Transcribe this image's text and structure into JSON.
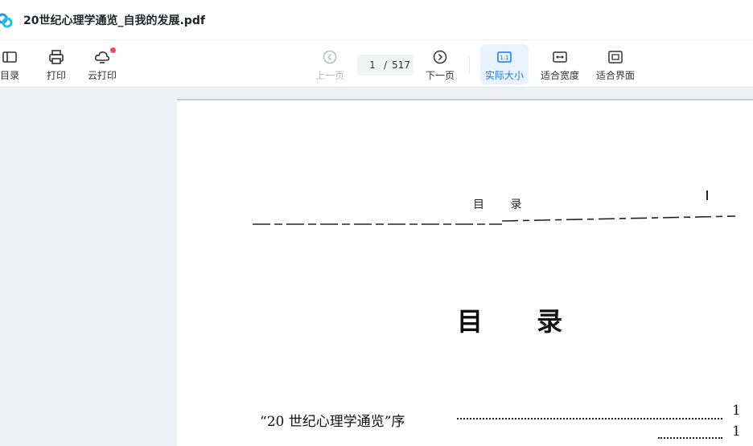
{
  "title_bar": {
    "document_title": "20世纪心理学通览_自我的发展.pdf",
    "logo_icon": "baidu-netdisk-logo"
  },
  "toolbar": {
    "left_tools": [
      {
        "label": "目录",
        "icon": "sidebar-panel-icon"
      },
      {
        "label": "打印",
        "icon": "printer-icon"
      },
      {
        "label": "云打印",
        "icon": "cloud-print-icon",
        "has_notification_dot": true
      }
    ],
    "prev_page_label": "上一页",
    "next_page_label": "下一页",
    "current_page": "1",
    "page_separator": "/",
    "total_pages": "517",
    "view_modes": [
      {
        "label": "实际大小",
        "icon": "actual-size-icon",
        "icon_text": "1:1",
        "active": true
      },
      {
        "label": "适合宽度",
        "icon": "fit-width-icon",
        "active": false
      },
      {
        "label": "适合界面",
        "icon": "fit-page-icon",
        "active": false
      }
    ]
  },
  "page_content": {
    "running_header": "目 录",
    "heading": "目 录",
    "toc_entries": [
      {
        "title": "“20 世纪心理学通览”序",
        "page": "1"
      },
      {
        "title": "",
        "page": "1"
      }
    ]
  },
  "colors": {
    "accent": "#1677ff",
    "active_bg": "#e8f3ff",
    "notification_dot": "#f5455c",
    "viewer_bg": "#eef0f3"
  }
}
